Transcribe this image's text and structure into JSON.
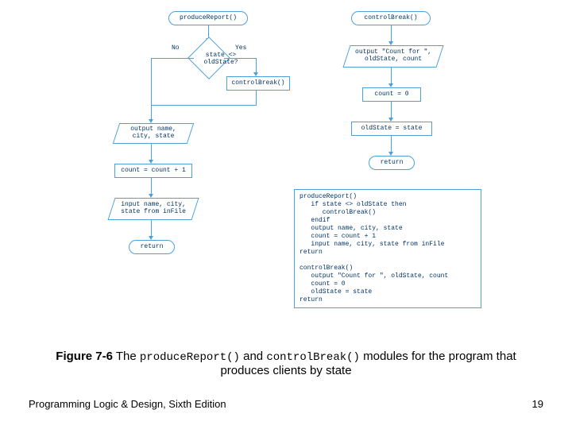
{
  "flowcharts": {
    "left": {
      "start": "produceReport()",
      "decision": "state <> oldState?",
      "decision_no": "No",
      "decision_yes": "Yes",
      "call_box": "controlBreak()",
      "io_output": "output name, city, state",
      "assign": "count = count + 1",
      "io_input": "input name, city, state from inFile",
      "return": "return"
    },
    "right": {
      "start": "controlBreak()",
      "io_output": "output \"Count for \", oldState, count",
      "assign1": "count = 0",
      "assign2": "oldState = state",
      "return": "return"
    }
  },
  "pseudocode": {
    "block1_head": "produceReport()",
    "block1_l1": "   if state <> oldState then",
    "block1_l2": "      controlBreak()",
    "block1_l3": "   endif",
    "block1_l4": "   output name, city, state",
    "block1_l5": "   count = count + 1",
    "block1_l6": "   input name, city, state from inFile",
    "block1_ret": "return",
    "block2_head": "controlBreak()",
    "block2_l1": "   output \"Count for \", oldState, count",
    "block2_l2": "   count = 0",
    "block2_l3": "   oldState = state",
    "block2_ret": "return"
  },
  "caption": {
    "prefix": "Figure 7-6",
    "text_before": " The ",
    "code1": "produceReport()",
    "text_mid": " and ",
    "code2": "controlBreak()",
    "text_after": " modules for the program that produces clients by state"
  },
  "footer": {
    "left": "Programming Logic & Design, Sixth Edition",
    "page": "19"
  }
}
